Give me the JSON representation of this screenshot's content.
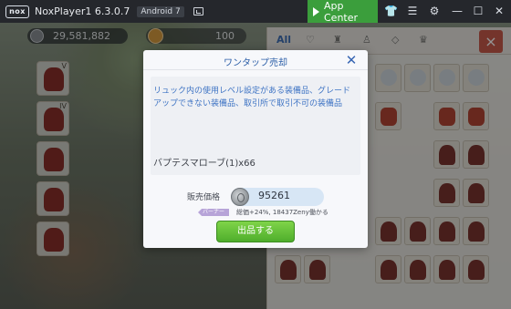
{
  "window": {
    "title": "NoxPlayer1 6.3.0.7",
    "android_badge": "Android 7",
    "app_center_label": "App Center",
    "logo_text": "nox",
    "colors": {
      "titlebar": "#25272c",
      "app_center": "#3b9e3c"
    }
  },
  "hud": {
    "zeny": "29,581,882",
    "other_currency": "100"
  },
  "equipment_slots": [
    {
      "roman": "V"
    },
    {
      "roman": "IV"
    },
    {
      "roman": ""
    },
    {
      "roman": ""
    },
    {
      "roman": ""
    }
  ],
  "inventory": {
    "tabs": [
      {
        "label": "All",
        "active": true
      },
      {
        "label": "♡",
        "active": false
      },
      {
        "label": "♜",
        "active": false
      },
      {
        "label": "♙",
        "active": false
      },
      {
        "label": "◇",
        "active": false
      },
      {
        "label": "♛",
        "active": false
      }
    ],
    "close_icon": "×"
  },
  "dialog": {
    "title": "ワンタップ売却",
    "close_icon": "✕",
    "notice": "リュック内の使用レベル設定がある装備品、グレードアップできない装備品、取引所で取引不可の装備品",
    "item": "バプテスマローブ(1)x66",
    "price_label": "販売価格",
    "price": "95261",
    "percent_tag": "バーナー",
    "percent_note": "総価+24%, 18437Zeny働かる",
    "sell_button": "出品する",
    "colors": {
      "accent": "#2d5fa8",
      "button": "#4fae2c"
    }
  }
}
